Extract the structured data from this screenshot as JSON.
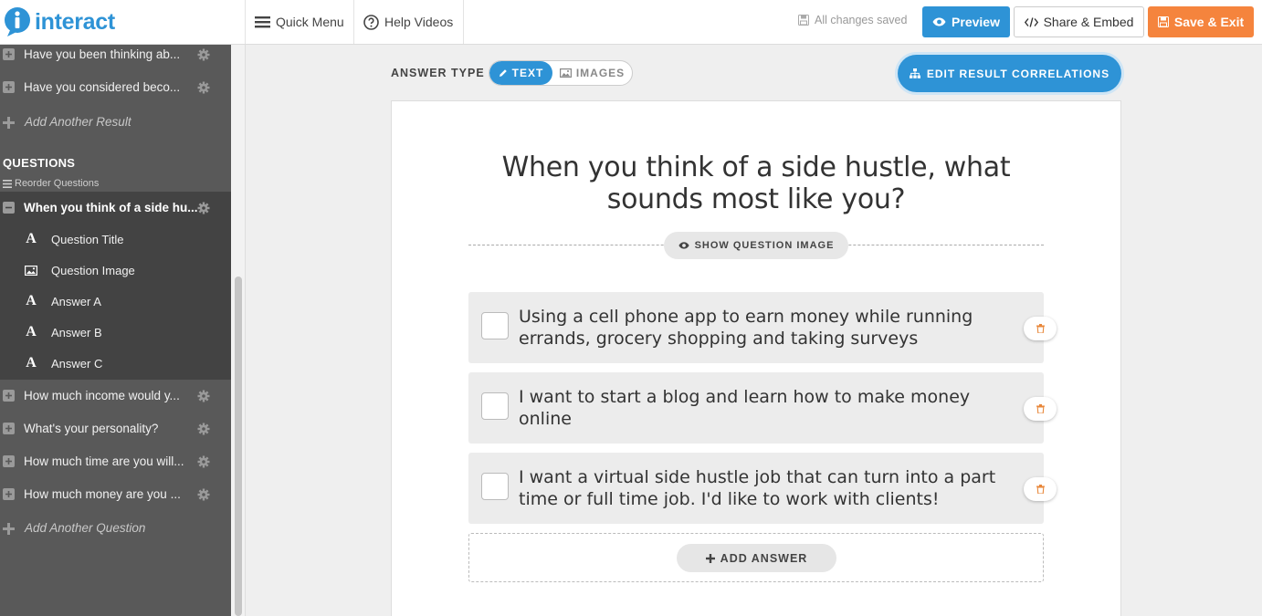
{
  "app": {
    "logo_text": "interact"
  },
  "topbar": {
    "quick_menu": "Quick Menu",
    "help_videos": "Help Videos",
    "saved_status": "All changes saved",
    "preview": "Preview",
    "share_embed": "Share & Embed",
    "save_exit": "Save & Exit"
  },
  "sidebar": {
    "results": [
      {
        "label": "Have you been thinking ab..."
      },
      {
        "label": "Have you considered beco..."
      }
    ],
    "add_result": "Add Another Result",
    "questions_heading": "QUESTIONS",
    "reorder": "Reorder Questions",
    "active_question": {
      "label": "When you think of a side hu...",
      "sub_items": [
        {
          "label": "Question Title",
          "icon": "text-icon"
        },
        {
          "label": "Question Image",
          "icon": "image-icon"
        },
        {
          "label": "Answer A",
          "icon": "text-icon"
        },
        {
          "label": "Answer B",
          "icon": "text-icon"
        },
        {
          "label": "Answer C",
          "icon": "text-icon"
        }
      ]
    },
    "questions": [
      {
        "label": "How much income would y..."
      },
      {
        "label": "What's your personality?"
      },
      {
        "label": "How much time are you will..."
      },
      {
        "label": "How much money are you ..."
      }
    ],
    "add_question": "Add Another Question"
  },
  "editor": {
    "answer_type_label": "ANSWER TYPE",
    "answer_type_options": [
      "TEXT",
      "IMAGES"
    ],
    "answer_type_selected": "TEXT",
    "edit_correlations": "EDIT RESULT CORRELATIONS",
    "question_title": "When you think of a side hustle, what sounds most like you?",
    "show_question_image": "SHOW QUESTION IMAGE",
    "answers": [
      {
        "text": "Using a cell phone app to earn money while running errands, grocery shopping and taking surveys"
      },
      {
        "text": "I want to start a blog and learn how to make money online"
      },
      {
        "text": "I want a virtual side hustle job that can turn into a part time or full time job. I'd like to work with clients!"
      }
    ],
    "add_answer": "ADD ANSWER"
  },
  "colors": {
    "primary": "#2e93d6",
    "save": "#f5843d",
    "sidebar": "#595959",
    "sidebar_active": "#434343"
  }
}
